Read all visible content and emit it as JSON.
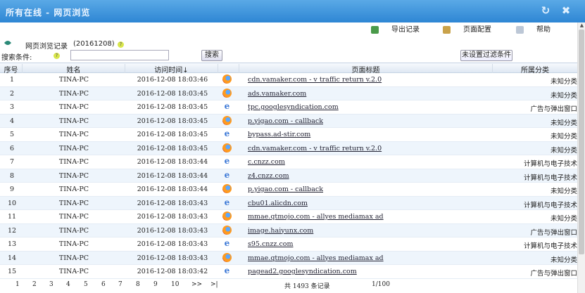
{
  "window": {
    "title": "所有在线 - 网页浏览"
  },
  "toolbar": {
    "export_label": "导出记录",
    "config_label": "页面配置",
    "help_label": "帮助"
  },
  "subheader": {
    "record_label": "网页浏览记录",
    "date": "(20161208)"
  },
  "search": {
    "label": "搜索条件:",
    "value": "",
    "search_button": "搜索",
    "filter_button": "未设置过滤条件"
  },
  "columns": {
    "no": "序号",
    "name": "姓名",
    "time": "访问时间↓",
    "title": "页面标题",
    "category": "所属分类"
  },
  "rows": [
    {
      "no": "1",
      "name": "TINA-PC",
      "time": "2016-12-08 18:03:46",
      "browser": "firefox",
      "title": "cdn.vamaker.com   -    v traffic return v.2.0",
      "category": "未知分类"
    },
    {
      "no": "2",
      "name": "TINA-PC",
      "time": "2016-12-08 18:03:45",
      "browser": "firefox",
      "title": "ads.vamaker.com",
      "category": "未知分类"
    },
    {
      "no": "3",
      "name": "TINA-PC",
      "time": "2016-12-08 18:03:45",
      "browser": "ie",
      "title": "tpc.googlesyndication.com",
      "category": "广告与弹出窗口"
    },
    {
      "no": "4",
      "name": "TINA-PC",
      "time": "2016-12-08 18:03:45",
      "browser": "firefox",
      "title": "p.yigao.com    -    callback",
      "category": "未知分类"
    },
    {
      "no": "5",
      "name": "TINA-PC",
      "time": "2016-12-08 18:03:45",
      "browser": "ie",
      "title": "bypass.ad-stir.com",
      "category": "未知分类"
    },
    {
      "no": "6",
      "name": "TINA-PC",
      "time": "2016-12-08 18:03:45",
      "browser": "firefox",
      "title": "cdn.vamaker.com   -    v traffic return v.2.0",
      "category": "未知分类"
    },
    {
      "no": "7",
      "name": "TINA-PC",
      "time": "2016-12-08 18:03:44",
      "browser": "ie",
      "title": "c.cnzz.com",
      "category": "计算机与电子技术"
    },
    {
      "no": "8",
      "name": "TINA-PC",
      "time": "2016-12-08 18:03:44",
      "browser": "ie",
      "title": "z4.cnzz.com",
      "category": "计算机与电子技术"
    },
    {
      "no": "9",
      "name": "TINA-PC",
      "time": "2016-12-08 18:03:44",
      "browser": "firefox",
      "title": "p.yigao.com    -    callback",
      "category": "未知分类"
    },
    {
      "no": "10",
      "name": "TINA-PC",
      "time": "2016-12-08 18:03:43",
      "browser": "ie",
      "title": "cbu01.alicdn.com",
      "category": "计算机与电子技术"
    },
    {
      "no": "11",
      "name": "TINA-PC",
      "time": "2016-12-08 18:03:43",
      "browser": "firefox",
      "title": "mmae.qtmojo.com   -    allyes mediamax ad",
      "category": "未知分类"
    },
    {
      "no": "12",
      "name": "TINA-PC",
      "time": "2016-12-08 18:03:43",
      "browser": "firefox",
      "title": "image.haiyunx.com",
      "category": "广告与弹出窗口"
    },
    {
      "no": "13",
      "name": "TINA-PC",
      "time": "2016-12-08 18:03:43",
      "browser": "ie",
      "title": "s95.cnzz.com",
      "category": "计算机与电子技术"
    },
    {
      "no": "14",
      "name": "TINA-PC",
      "time": "2016-12-08 18:03:43",
      "browser": "firefox",
      "title": "mmae.qtmojo.com   -    allyes mediamax ad",
      "category": "未知分类"
    },
    {
      "no": "15",
      "name": "TINA-PC",
      "time": "2016-12-08 18:03:42",
      "browser": "ie",
      "title": "pagead2.googlesyndication.com",
      "category": "广告与弹出窗口"
    }
  ],
  "pager": {
    "pages": [
      "1",
      "2",
      "3",
      "4",
      "5",
      "6",
      "7",
      "8",
      "9",
      "10",
      ">>",
      ">|"
    ],
    "total": "共 1493 条记录",
    "page_info": "1/100"
  },
  "colors": {
    "titlebar": "#3a90d8",
    "row_alt": "#eef5fc"
  }
}
